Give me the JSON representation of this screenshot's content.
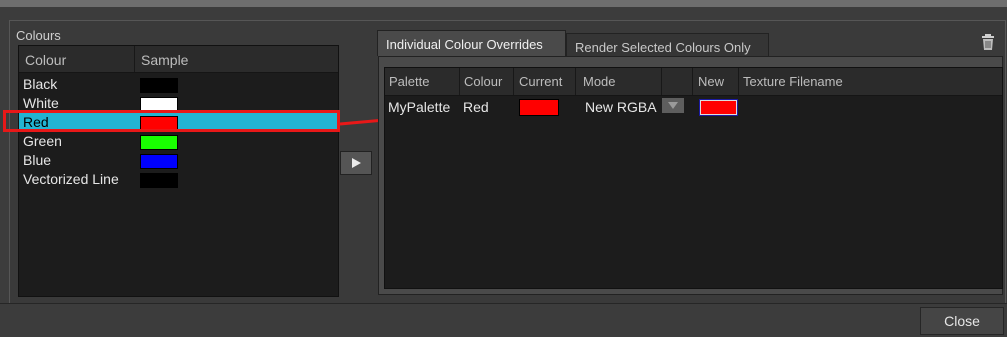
{
  "colours_panel": {
    "title": "Colours",
    "headers": {
      "colour": "Colour",
      "sample": "Sample"
    },
    "rows": [
      {
        "label": "Black",
        "color": "#000000"
      },
      {
        "label": "White",
        "color": "#ffffff"
      },
      {
        "label": "Red",
        "color": "#ff0000"
      },
      {
        "label": "Green",
        "color": "#19ff00"
      },
      {
        "label": "Blue",
        "color": "#0000ff"
      },
      {
        "label": "Vectorized Line",
        "color": "#000000"
      }
    ],
    "selected_index": 2,
    "selection_color": "#22b4d2",
    "annotation_color": "#e81818"
  },
  "tabs": {
    "individual": "Individual Colour Overrides",
    "render_selected": "Render Selected Colours Only"
  },
  "overrides_table": {
    "headers": {
      "palette": "Palette",
      "colour": "Colour",
      "current": "Current",
      "mode": "Mode",
      "new": "New",
      "texture": "Texture Filename"
    },
    "rows": [
      {
        "palette": "MyPalette",
        "colour": "Red",
        "current_color": "#ff0000",
        "mode": "New RGBA",
        "new_color": "#ff0000"
      }
    ]
  },
  "icons": {
    "add": "play-triangle-icon",
    "delete": "trash-icon",
    "mode_dropdown": "chevron-down-icon"
  },
  "footer": {
    "close_label": "Close"
  }
}
